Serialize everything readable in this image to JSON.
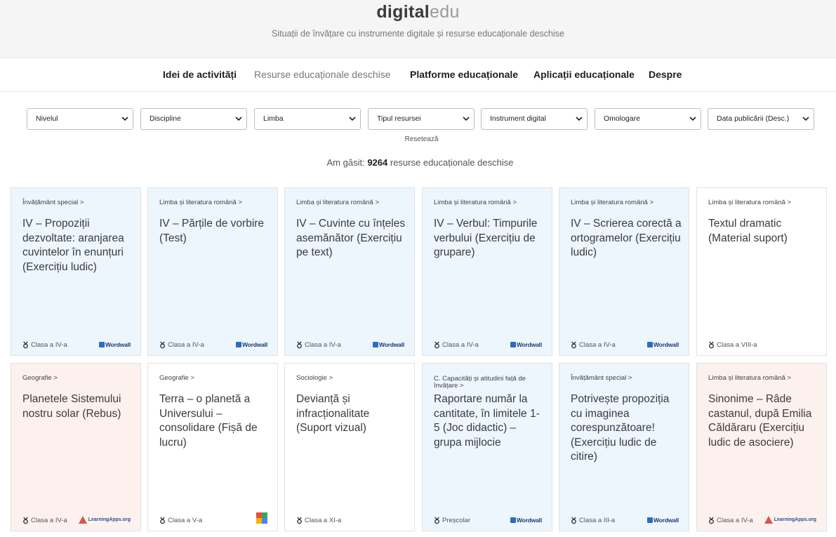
{
  "header": {
    "logo_bold": "digital",
    "logo_light": "edu",
    "tagline": "Situații de învățare cu instrumente digitale și resurse educaționale deschise"
  },
  "nav": [
    {
      "label": "Idei de activități",
      "active": false
    },
    {
      "label": "Resurse educaționale deschise",
      "active": true
    },
    {
      "label": "Platforme educaționale",
      "active": false
    },
    {
      "label": "Aplicații educaționale",
      "active": false
    },
    {
      "label": "Despre",
      "active": false
    }
  ],
  "filters": [
    {
      "selected": "Nivelul"
    },
    {
      "selected": "Discipline"
    },
    {
      "selected": "Limba"
    },
    {
      "selected": "Tipul resursei"
    },
    {
      "selected": "Instrument digital"
    },
    {
      "selected": "Omologare"
    },
    {
      "selected": "Data publicării (Desc.)"
    }
  ],
  "reset_label": "Resetează",
  "results": {
    "prefix": "Am găsit:",
    "count": "9264",
    "suffix": "resurse educaționale deschise"
  },
  "cards": [
    {
      "category": "Învățământ special >",
      "title": "IV – Propoziții dezvoltate: aranjarea cuvintelor în enunțuri (Exercițiu ludic)",
      "grade": "Clasa a IV-a",
      "tool": "Wordwall",
      "color": "#edf5fd"
    },
    {
      "category": "Limba și literatura română >",
      "title": "IV – Părțile de vorbire (Test)",
      "grade": "Clasa a IV-a",
      "tool": "Wordwall",
      "color": "#edf5fd"
    },
    {
      "category": "Limba și literatura română >",
      "title": "IV – Cuvinte cu înțeles asemănător (Exercițiu pe text)",
      "grade": "Clasa a IV-a",
      "tool": "Wordwall",
      "color": "#edf5fd"
    },
    {
      "category": "Limba și literatura română >",
      "title": "IV – Verbul: Timpurile verbului (Exercițiu de grupare)",
      "grade": "Clasa a IV-a",
      "tool": "Wordwall",
      "color": "#edf5fd"
    },
    {
      "category": "Limba și literatura română >",
      "title": "IV – Scrierea corectă a ortogramelor (Exercițiu ludic)",
      "grade": "Clasa a IV-a",
      "tool": "Wordwall",
      "color": "#edf5fd"
    },
    {
      "category": "Limba și literatura română >",
      "title": "Textul dramatic (Material suport)",
      "grade": "Clasa a VIII-a",
      "tool": "",
      "color": "#ffffff"
    },
    {
      "category": "Geografie >",
      "title": "Planetele Sistemului nostru solar (Rebus)",
      "grade": "Clasa a IV-a",
      "tool": "LearningApps.org",
      "color": "#fdf1ee"
    },
    {
      "category": "Geografie >",
      "title": "Terra – o planetă a Universului – consolidare (Fișă de lucru)",
      "grade": "Clasa a V-a",
      "tool": "LiveWorksheets",
      "color": "#ffffff"
    },
    {
      "category": "Sociologie >",
      "title": "Devianță și infracționalitate (Suport vizual)",
      "grade": "Clasa a XI-a",
      "tool": "",
      "color": "#ffffff"
    },
    {
      "category": "C. Capacități și atitudini față de învățare >",
      "title": "Raportare număr la cantitate, în limitele 1-5 (Joc didactic) – grupa mijlocie",
      "grade": "Preșcolar",
      "tool": "Wordwall",
      "color": "#edf5fd"
    },
    {
      "category": "Învățământ special >",
      "title": "Potrivește propoziția cu imaginea corespunzătoare! (Exercițiu ludic de citire)",
      "grade": "Clasa a III-a",
      "tool": "Wordwall",
      "color": "#edf5fd"
    },
    {
      "category": "Limba și literatura română >",
      "title": "Sinonime – Râde castanul, după Emilia Căldăraru (Exercițiu ludic de asociere)",
      "grade": "Clasa a IV-a",
      "tool": "LearningApps.org",
      "color": "#fdf1ee"
    }
  ]
}
